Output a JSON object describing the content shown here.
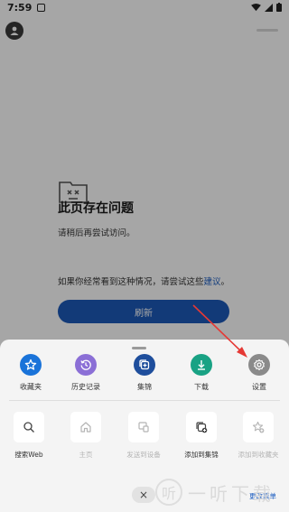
{
  "status_bar": {
    "time": "7:59"
  },
  "error_page": {
    "title": "此页存在问题",
    "line1": "请稍后再尝试访问。",
    "line2_prefix": "如果你经常看到这种情况，请尝试这些",
    "line2_link": "建议",
    "line2_suffix": "。",
    "refresh_label": "刷新"
  },
  "quick_actions": [
    {
      "label": "收藏夹",
      "icon": "star-icon",
      "color": "#1a73d9"
    },
    {
      "label": "历史记录",
      "icon": "history-icon",
      "color": "#8b6fd6"
    },
    {
      "label": "集锦",
      "icon": "collections-icon",
      "color": "#1e4e9c"
    },
    {
      "label": "下载",
      "icon": "download-icon",
      "color": "#19a284"
    },
    {
      "label": "设置",
      "icon": "settings-icon",
      "color": "#8a8a8a"
    }
  ],
  "tiles": [
    {
      "label": "搜索Web",
      "icon": "search-icon",
      "enabled": true
    },
    {
      "label": "主页",
      "icon": "home-icon",
      "enabled": false
    },
    {
      "label": "发送到设备",
      "icon": "send-to-device-icon",
      "enabled": false
    },
    {
      "label": "添加到集锦",
      "icon": "add-to-collection-icon",
      "enabled": true
    },
    {
      "label": "添加到收藏夹",
      "icon": "add-to-favorites-icon",
      "enabled": false
    }
  ],
  "sheet": {
    "close_symbol": "×",
    "change_menu_label": "更改菜单"
  },
  "watermark": {
    "text": "一听下载",
    "glyph": "听"
  }
}
